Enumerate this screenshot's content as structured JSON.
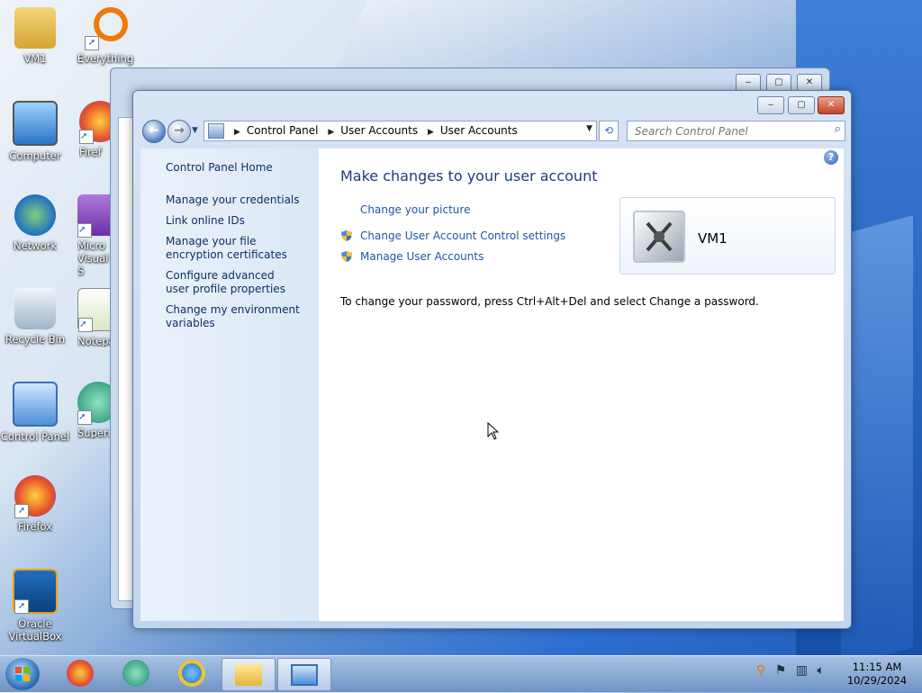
{
  "desktop": {
    "icons": [
      {
        "label": "VM1"
      },
      {
        "label": "Everything"
      },
      {
        "label": "Computer"
      },
      {
        "label": "Firef"
      },
      {
        "label": "Network"
      },
      {
        "label": "Micro Visual S"
      },
      {
        "label": "Recycle Bin"
      },
      {
        "label": "Notepa"
      },
      {
        "label": "Control Panel"
      },
      {
        "label": "Superr"
      },
      {
        "label": "Firefox"
      },
      {
        "label": "Oracle VirtualBox"
      }
    ]
  },
  "window": {
    "buttons": {
      "minimize": "‒",
      "maximize": "▢",
      "close": "✕"
    },
    "breadcrumb": [
      "Control Panel",
      "User Accounts",
      "User Accounts"
    ],
    "search_placeholder": "Search Control Panel",
    "left_pane": {
      "home": "Control Panel Home",
      "links": [
        "Manage your credentials",
        "Link online IDs",
        "Manage your file encryption certificates",
        "Configure advanced user profile properties",
        "Change my environment variables"
      ]
    },
    "main": {
      "title": "Make changes to your user account",
      "tasks": [
        "Change your picture",
        "Change User Account Control settings",
        "Manage User Accounts"
      ],
      "user_name": "VM1",
      "note": "To change your password, press Ctrl+Alt+Del and select Change a password."
    }
  },
  "taskbar": {
    "clock_time": "11:15 AM",
    "clock_date": "10/29/2024"
  },
  "colors": {
    "link": "#1f55a8",
    "title": "#1e3c79",
    "left_pane_text": "#0d2f64"
  }
}
